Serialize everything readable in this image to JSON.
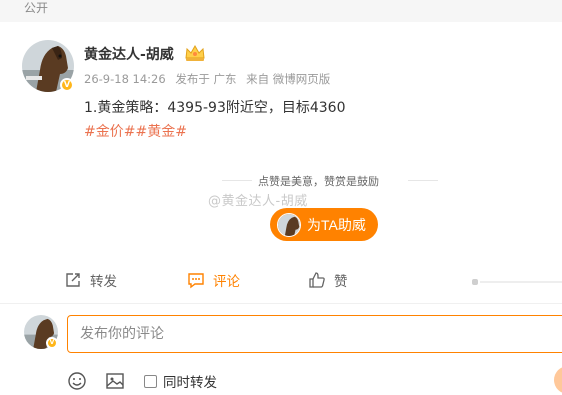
{
  "visibility": "公开",
  "author": {
    "name": "黄金达人-胡威",
    "verified_badge": "V",
    "crown_icon": "crown-icon"
  },
  "meta": {
    "time": "26-9-18 14:26",
    "location": "发布于 广东",
    "source": "来自 微博网页版"
  },
  "post": {
    "text": "1.黄金策略：4395-93附近空，目标4360",
    "hashtags": "#金价##黄金#"
  },
  "reward": {
    "caption": "点赞是美意，赞赏是鼓励",
    "watermark": "@黄金达人-胡威",
    "button_label": "为TA助威"
  },
  "actions": {
    "repost": "转发",
    "comment": "评论",
    "like": "赞"
  },
  "composer": {
    "placeholder": "发布你的评论",
    "repost_toggle": "同时转发",
    "emoji_icon": "emoji-icon",
    "image_icon": "image-icon"
  },
  "colors": {
    "accent": "#ff8200",
    "hashtag": "#eb7350",
    "badge": "#ffb61a"
  }
}
